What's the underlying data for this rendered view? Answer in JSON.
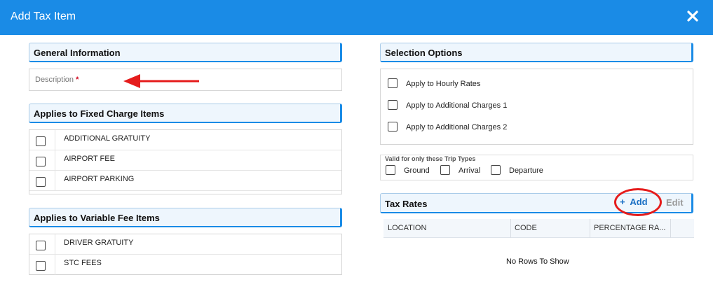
{
  "dialog": {
    "title": "Add Tax Item",
    "close_icon": "close-icon"
  },
  "general": {
    "header": "General Information",
    "description_label": "Description",
    "required_marker": "*"
  },
  "fixed_charge": {
    "header": "Applies to Fixed Charge Items",
    "items": [
      {
        "label": "ADDITIONAL GRATUITY",
        "checked": false
      },
      {
        "label": "AIRPORT FEE",
        "checked": false
      },
      {
        "label": "AIRPORT PARKING",
        "checked": false
      }
    ]
  },
  "variable_fee": {
    "header": "Applies to Variable Fee Items",
    "items": [
      {
        "label": "DRIVER GRATUITY",
        "checked": false
      },
      {
        "label": "STC FEES",
        "checked": false
      }
    ]
  },
  "selection": {
    "header": "Selection Options",
    "options": [
      {
        "label": "Apply to Hourly Rates",
        "checked": false
      },
      {
        "label": "Apply to Additional Charges 1",
        "checked": false
      },
      {
        "label": "Apply to Additional Charges 2",
        "checked": false
      }
    ]
  },
  "trip_types": {
    "title": "Valid for only these Trip Types",
    "options": [
      {
        "label": "Ground",
        "checked": false
      },
      {
        "label": "Arrival",
        "checked": false
      },
      {
        "label": "Departure",
        "checked": false
      }
    ]
  },
  "tax_rates": {
    "header": "Tax Rates",
    "add_label": "Add",
    "add_icon": "+",
    "edit_label": "Edit",
    "columns": [
      "LOCATION",
      "CODE",
      "PERCENTAGE RA..."
    ],
    "empty_text": "No Rows To Show"
  },
  "colors": {
    "accent": "#1a8be6",
    "annotation": "#e51c1c"
  }
}
